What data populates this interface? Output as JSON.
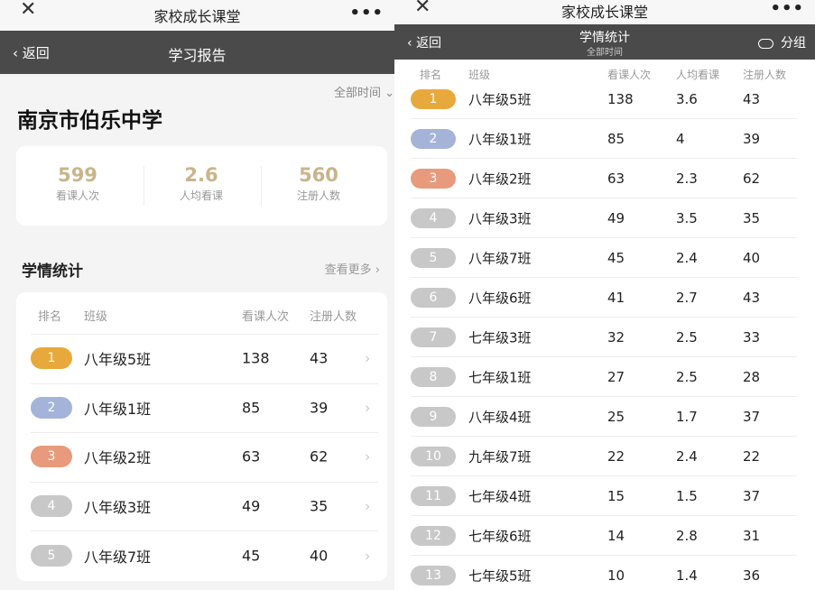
{
  "colors": {
    "rank1": "#e8a93c",
    "rank2": "#a5b3d8",
    "rank3": "#e89a7c",
    "rank_other": "#c8c8c8"
  },
  "left": {
    "topbar": {
      "close_icon": "close-icon",
      "title": "家校成长课堂",
      "more": "•••"
    },
    "navbar": {
      "back_label": "返回",
      "title": "学习报告"
    },
    "filter": "全部时间",
    "school_name": "南京市伯乐中学",
    "stats": [
      {
        "value": "599",
        "label": "看课人次"
      },
      {
        "value": "2.6",
        "label": "人均看课"
      },
      {
        "value": "560",
        "label": "注册人数"
      }
    ],
    "section_title": "学情统计",
    "more_label": "查看更多",
    "headers": {
      "rank": "排名",
      "class": "班级",
      "views": "看课人次",
      "registered": "注册人数"
    },
    "rows": [
      {
        "rank": "1",
        "class": "八年级5班",
        "views": "138",
        "registered": "43"
      },
      {
        "rank": "2",
        "class": "八年级1班",
        "views": "85",
        "registered": "39"
      },
      {
        "rank": "3",
        "class": "八年级2班",
        "views": "63",
        "registered": "62"
      },
      {
        "rank": "4",
        "class": "八年级3班",
        "views": "49",
        "registered": "35"
      },
      {
        "rank": "5",
        "class": "八年级7班",
        "views": "45",
        "registered": "40"
      }
    ]
  },
  "right": {
    "topbar": {
      "close_icon": "close-icon",
      "title": "家校成长课堂",
      "more": "•••"
    },
    "navbar": {
      "back_label": "返回",
      "title": "学情统计",
      "subtitle": "全部时间",
      "group_label": "分组"
    },
    "headers": {
      "rank": "排名",
      "class": "班级",
      "views": "看课人次",
      "avg": "人均看课",
      "registered": "注册人数"
    },
    "rows": [
      {
        "rank": "1",
        "class": "八年级5班",
        "views": "138",
        "avg": "3.6",
        "registered": "43"
      },
      {
        "rank": "2",
        "class": "八年级1班",
        "views": "85",
        "avg": "4",
        "registered": "39"
      },
      {
        "rank": "3",
        "class": "八年级2班",
        "views": "63",
        "avg": "2.3",
        "registered": "62"
      },
      {
        "rank": "4",
        "class": "八年级3班",
        "views": "49",
        "avg": "3.5",
        "registered": "35"
      },
      {
        "rank": "5",
        "class": "八年级7班",
        "views": "45",
        "avg": "2.4",
        "registered": "40"
      },
      {
        "rank": "6",
        "class": "八年级6班",
        "views": "41",
        "avg": "2.7",
        "registered": "43"
      },
      {
        "rank": "7",
        "class": "七年级3班",
        "views": "32",
        "avg": "2.5",
        "registered": "33"
      },
      {
        "rank": "8",
        "class": "七年级1班",
        "views": "27",
        "avg": "2.5",
        "registered": "28"
      },
      {
        "rank": "9",
        "class": "八年级4班",
        "views": "25",
        "avg": "1.7",
        "registered": "37"
      },
      {
        "rank": "10",
        "class": "九年级7班",
        "views": "22",
        "avg": "2.4",
        "registered": "22"
      },
      {
        "rank": "11",
        "class": "七年级4班",
        "views": "15",
        "avg": "1.5",
        "registered": "37"
      },
      {
        "rank": "12",
        "class": "七年级6班",
        "views": "14",
        "avg": "2.8",
        "registered": "31"
      },
      {
        "rank": "13",
        "class": "七年级5班",
        "views": "10",
        "avg": "1.4",
        "registered": "36"
      }
    ]
  }
}
